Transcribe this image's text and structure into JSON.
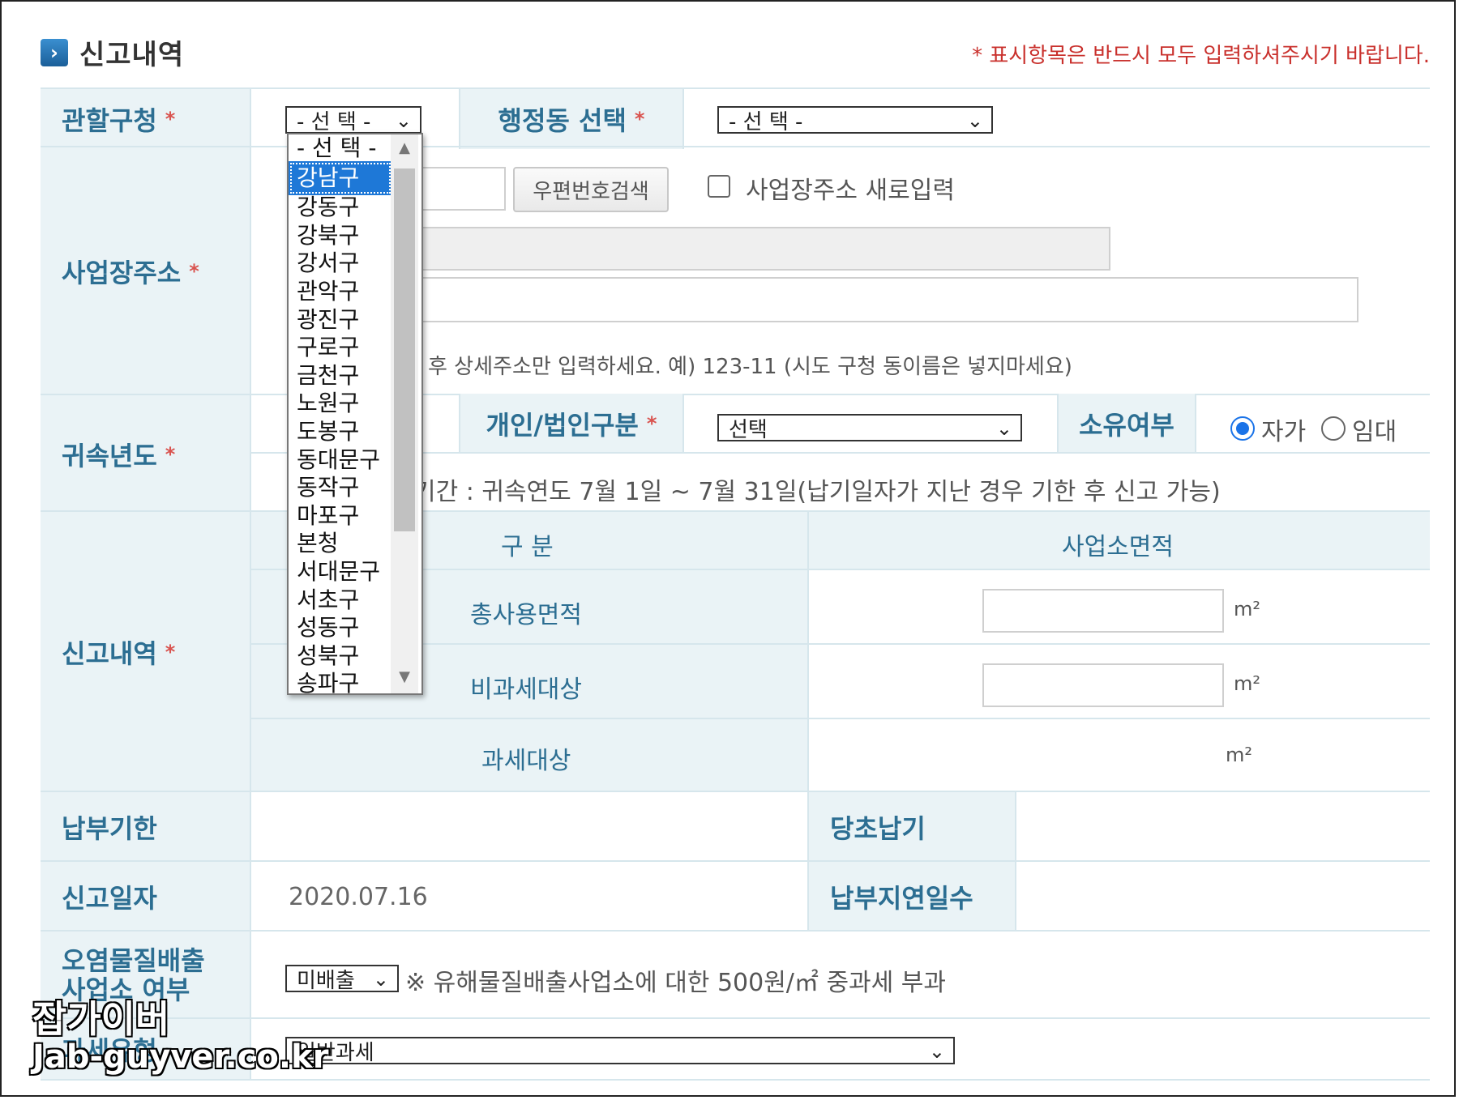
{
  "section": {
    "title": "신고내역",
    "required_note": "* 표시항목은 반드시 모두 입력하셔주시기 바랍니다."
  },
  "labels": {
    "district": "관할구청",
    "admin_dong": "행정동 선택",
    "biz_address": "사업장주소",
    "attribution_year": "귀속년도",
    "person_type": "개인/법인구분",
    "ownership": "소유여부",
    "report_details": "신고내역",
    "due_date": "납부기한",
    "initial_due": "당초납기",
    "report_date": "신고일자",
    "late_days": "납부지연일수",
    "pollutant": "오염물질배출",
    "pollutant_line2": "사업소 여부",
    "tax_type_partial": "과세유형"
  },
  "star": "*",
  "district_select": {
    "value": "- 선 택 -"
  },
  "dong_select": {
    "value": "- 선 택 -"
  },
  "district_options": [
    "- 선 택 -",
    "강남구",
    "강동구",
    "강북구",
    "강서구",
    "관악구",
    "광진구",
    "구로구",
    "금천구",
    "노원구",
    "도봉구",
    "동대문구",
    "동작구",
    "마포구",
    "본청",
    "서대문구",
    "서초구",
    "성동구",
    "성북구",
    "송파구"
  ],
  "district_highlighted": "강남구",
  "postcode_button": "우편번호검색",
  "new_address_checkbox": "사업장주소 새로입력",
  "address_hint": "후 상세주소만 입력하세요. 예) 123-11 (시도 구청 동이름은 넣지마세요)",
  "person_select": {
    "value": "선택"
  },
  "ownership_options": [
    "자가",
    "임대"
  ],
  "ownership_selected": "자가",
  "period_hint": "기간 : 귀속연도 7월 1일 ~ 7월 31일(납기일자가 지난 경우 기한 후 신고 가능)",
  "area_table": {
    "header_category": "구 분",
    "header_area": "사업소면적",
    "rows": [
      "총사용면적",
      "비과세대상",
      "과세대상"
    ],
    "unit": "m²"
  },
  "report_date_value": "2020.07.16",
  "pollutant_select": {
    "value": "미배출"
  },
  "pollutant_note": "※ 유해물질배출사업소에 대한 500원/㎡ 중과세 부과",
  "tax_type_select": {
    "value": "일반과세"
  },
  "watermark": {
    "line1": "잡가이버",
    "line2": "Jab-guyver.co.kr"
  }
}
